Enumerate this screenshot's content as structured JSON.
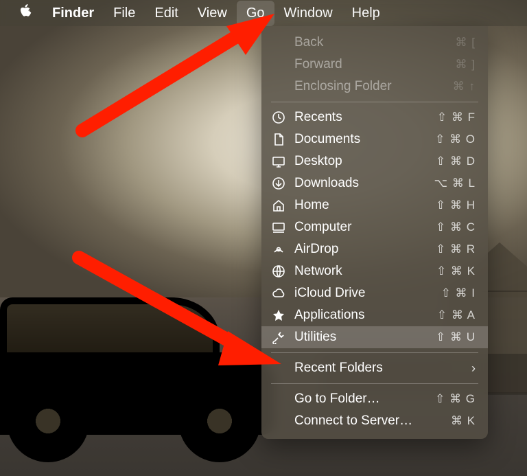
{
  "menubar": {
    "app": "Finder",
    "items": [
      "File",
      "Edit",
      "View",
      "Go",
      "Window",
      "Help"
    ],
    "active": "Go"
  },
  "menu": {
    "disabled": [
      {
        "label": "Back",
        "shortcut": "⌘ ["
      },
      {
        "label": "Forward",
        "shortcut": "⌘ ]"
      },
      {
        "label": "Enclosing Folder",
        "shortcut": "⌘ ↑"
      }
    ],
    "items": [
      {
        "icon": "clock-icon",
        "label": "Recents",
        "shortcut": "⇧ ⌘ F"
      },
      {
        "icon": "document-icon",
        "label": "Documents",
        "shortcut": "⇧ ⌘ O"
      },
      {
        "icon": "desktop-icon",
        "label": "Desktop",
        "shortcut": "⇧ ⌘ D"
      },
      {
        "icon": "download-icon",
        "label": "Downloads",
        "shortcut": "⌥ ⌘ L"
      },
      {
        "icon": "home-icon",
        "label": "Home",
        "shortcut": "⇧ ⌘ H"
      },
      {
        "icon": "computer-icon",
        "label": "Computer",
        "shortcut": "⇧ ⌘ C"
      },
      {
        "icon": "airdrop-icon",
        "label": "AirDrop",
        "shortcut": "⇧ ⌘ R"
      },
      {
        "icon": "network-icon",
        "label": "Network",
        "shortcut": "⇧ ⌘ K"
      },
      {
        "icon": "cloud-icon",
        "label": "iCloud Drive",
        "shortcut": "⇧ ⌘ I"
      },
      {
        "icon": "apps-icon",
        "label": "Applications",
        "shortcut": "⇧ ⌘ A"
      },
      {
        "icon": "tools-icon",
        "label": "Utilities",
        "shortcut": "⇧ ⌘ U",
        "highlight": true
      }
    ],
    "recent_folders": {
      "label": "Recent Folders"
    },
    "footer": [
      {
        "label": "Go to Folder…",
        "shortcut": "⇧ ⌘ G"
      },
      {
        "label": "Connect to Server…",
        "shortcut": "⌘ K"
      }
    ]
  },
  "colors": {
    "arrow": "#ff1e00"
  }
}
